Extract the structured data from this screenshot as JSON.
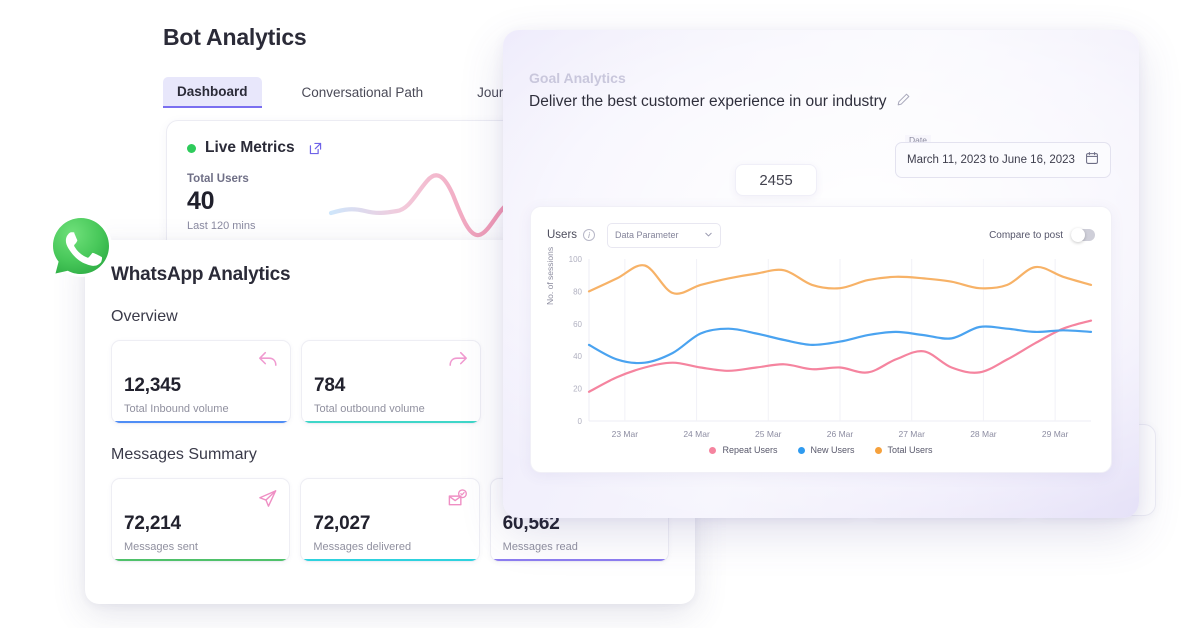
{
  "bot": {
    "title": "Bot Analytics",
    "tabs": [
      {
        "label": "Dashboard",
        "active": true
      },
      {
        "label": "Conversational Path",
        "active": false
      },
      {
        "label": "Journey Tracking",
        "active": false
      }
    ],
    "live_card": {
      "title": "Live Metrics",
      "status_icon": "green-dot-icon",
      "external_icon": "external-link-icon",
      "metric_label": "Total Users",
      "metric_value": "40",
      "metric_sub": "Last 120 mins"
    }
  },
  "whatsapp": {
    "logo_icon": "whatsapp-logo-icon",
    "title": "WhatsApp Analytics",
    "overview_heading": "Overview",
    "overview_cards": [
      {
        "value": "12,345",
        "caption": "Total Inbound volume",
        "icon": "reply-arrow-icon",
        "accent": "#4f8df5"
      },
      {
        "value": "784",
        "caption": "Total outbound volume",
        "icon": "forward-arrow-icon",
        "accent": "#3fd6c8"
      }
    ],
    "messages_heading": "Messages Summary",
    "messages_cards": [
      {
        "value": "72,214",
        "caption": "Messages sent",
        "icon": "send-plane-icon",
        "accent": "#4fc16a"
      },
      {
        "value": "72,027",
        "caption": "Messages delivered",
        "icon": "mail-check-icon",
        "accent": "#2ed2de"
      },
      {
        "value": "60,562",
        "caption": "Messages read",
        "icon": "mail-open-icon",
        "accent": "#8d7df0"
      }
    ]
  },
  "goal": {
    "kicker": "Goal Analytics",
    "headline": "Deliver the best customer experience in our industry",
    "edit_icon": "pencil-edit-icon",
    "count_value": "2455",
    "date": {
      "legend": "Date",
      "value": "March 11, 2023 to June 16, 2023",
      "icon": "calendar-icon"
    },
    "chart_card": {
      "metric_label": "Users",
      "info_icon": "info-circle-icon",
      "select_value": "Data Parameter",
      "chevron_icon": "chevron-down-icon",
      "compare_label": "Compare to post",
      "compare_on": false
    }
  },
  "chart_data": {
    "type": "line",
    "title": "",
    "xlabel": "",
    "ylabel": "No. of sessions",
    "ylim": [
      0,
      100
    ],
    "yticks": [
      0,
      20,
      40,
      60,
      80,
      100
    ],
    "categories": [
      "23 Mar",
      "24 Mar",
      "25 Mar",
      "26 Mar",
      "27 Mar",
      "28 Mar",
      "29 Mar"
    ],
    "grid": true,
    "legend_position": "bottom",
    "series": [
      {
        "name": "Repeat Users",
        "color": "#f5849f",
        "values": [
          18,
          27,
          33,
          36,
          33,
          31,
          33,
          35,
          32,
          33,
          30,
          38,
          43,
          33,
          30,
          38,
          48,
          57,
          62
        ]
      },
      {
        "name": "New Users",
        "color": "#4aa3f0",
        "values": [
          47,
          38,
          36,
          42,
          54,
          57,
          54,
          50,
          47,
          49,
          53,
          55,
          53,
          51,
          58,
          57,
          55,
          56,
          55
        ]
      },
      {
        "name": "Total Users",
        "color": "#f7b267",
        "values": [
          80,
          88,
          96,
          79,
          84,
          88,
          91,
          93,
          84,
          82,
          87,
          89,
          88,
          86,
          82,
          84,
          95,
          89,
          84
        ]
      }
    ]
  }
}
